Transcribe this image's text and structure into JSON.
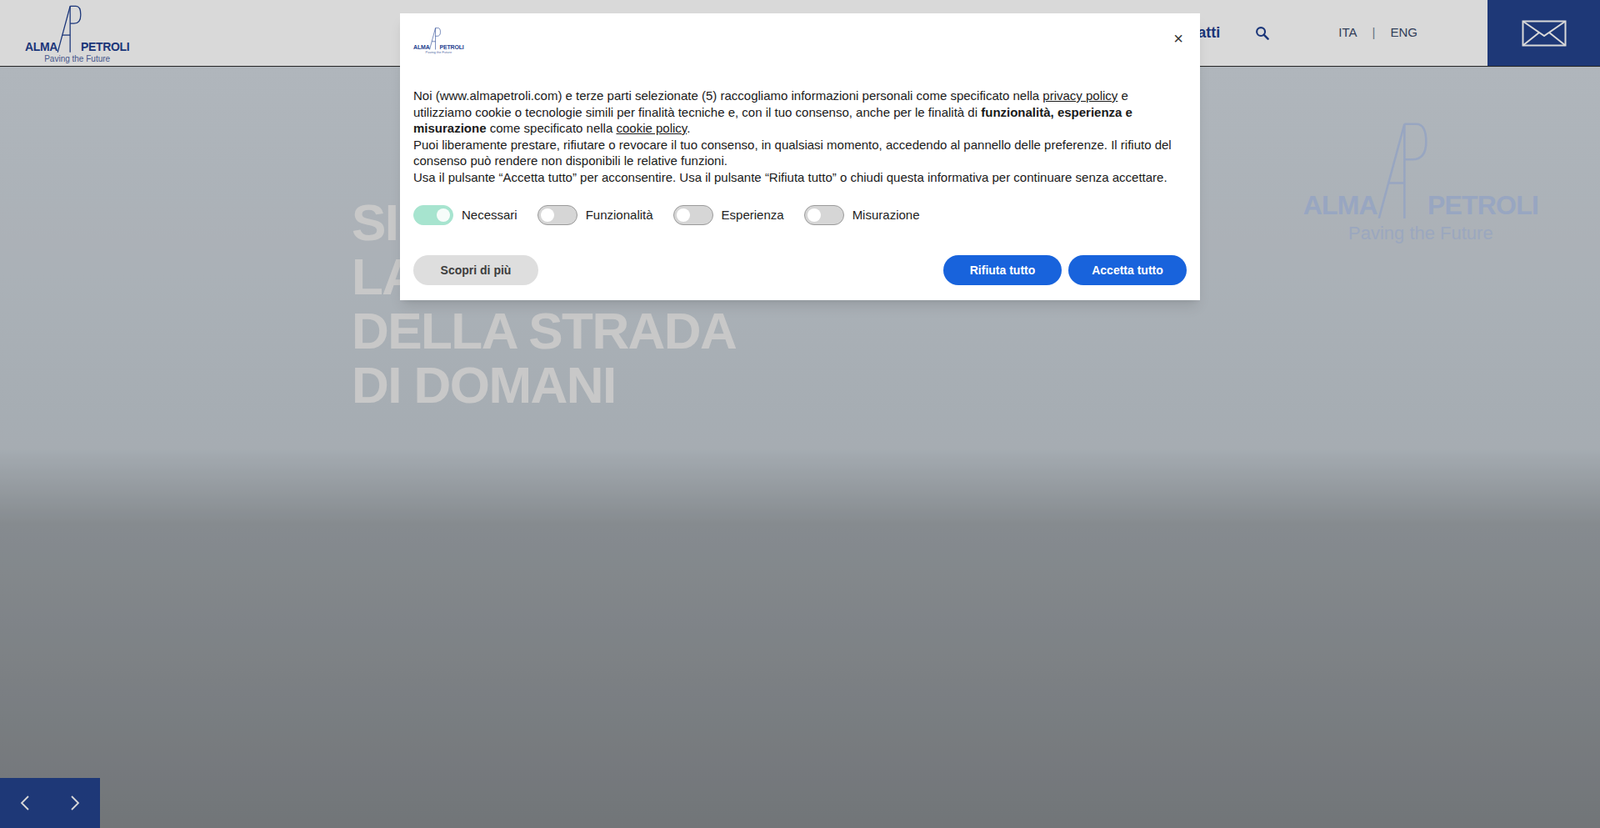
{
  "header": {
    "logo": {
      "word_left": "ALMA",
      "word_right": "PETROLI",
      "tagline": "Paving the Future"
    },
    "nav": [
      {
        "label": "ntatti"
      }
    ],
    "languages": [
      {
        "label": "ITA"
      },
      {
        "label": "ENG"
      }
    ],
    "language_separator": "|"
  },
  "hero": {
    "headline": [
      "SI",
      "LA",
      "DELLA STRADA",
      "DI DOMANI"
    ],
    "logo": {
      "word_left": "ALMA",
      "word_right": "PETROLI",
      "tagline": "Paving the Future"
    }
  },
  "cookie_banner": {
    "logo": {
      "word_left": "ALMA",
      "word_right": "PETROLI",
      "tagline": "Paving the Future"
    },
    "close": "×",
    "paragraphs": [
      [
        {
          "kind": "text",
          "text": "Noi (www.almapetroli.com) e terze parti selezionate (5) raccogliamo informazioni personali come specificato nella "
        },
        {
          "kind": "link",
          "text": "privacy policy"
        },
        {
          "kind": "text",
          "text": " e utilizziamo cookie o tecnologie simili per finalità tecniche e, con il tuo consenso, anche per le finalità di "
        },
        {
          "kind": "bold",
          "text": "funzionalità, esperienza e misurazione"
        },
        {
          "kind": "text",
          "text": " come specificato nella "
        },
        {
          "kind": "link",
          "text": "cookie policy"
        },
        {
          "kind": "text",
          "text": "."
        }
      ],
      [
        {
          "kind": "text",
          "text": "Puoi liberamente prestare, rifiutare o revocare il tuo consenso, in qualsiasi momento, accedendo al pannello delle preferenze. Il rifiuto del consenso può rendere non disponibili le relative funzioni."
        }
      ],
      [
        {
          "kind": "text",
          "text": "Usa il pulsante “Accetta tutto” per acconsentire. Usa il pulsante “Rifiuta tutto” o chiudi questa informativa per continuare senza accettare."
        }
      ]
    ],
    "toggles": [
      {
        "label": "Necessari",
        "on": true
      },
      {
        "label": "Funzionalità",
        "on": false
      },
      {
        "label": "Esperienza",
        "on": false
      },
      {
        "label": "Misurazione",
        "on": false
      }
    ],
    "buttons": [
      {
        "label": "Scopri di più",
        "kind": "secondary"
      },
      {
        "label": "Rifiuta tutto",
        "kind": "primary"
      },
      {
        "label": "Accetta tutto",
        "kind": "primary"
      }
    ]
  }
}
